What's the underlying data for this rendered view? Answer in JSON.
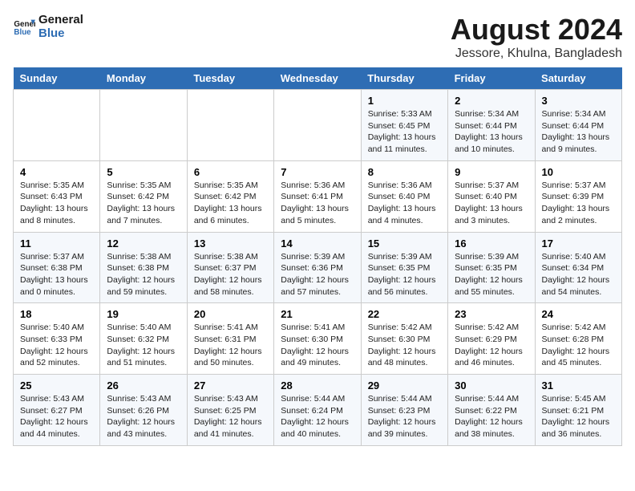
{
  "header": {
    "logo_line1": "General",
    "logo_line2": "Blue",
    "title": "August 2024",
    "subtitle": "Jessore, Khulna, Bangladesh"
  },
  "days_of_week": [
    "Sunday",
    "Monday",
    "Tuesday",
    "Wednesday",
    "Thursday",
    "Friday",
    "Saturday"
  ],
  "weeks": [
    [
      {
        "day": "",
        "detail": ""
      },
      {
        "day": "",
        "detail": ""
      },
      {
        "day": "",
        "detail": ""
      },
      {
        "day": "",
        "detail": ""
      },
      {
        "day": "1",
        "detail": "Sunrise: 5:33 AM\nSunset: 6:45 PM\nDaylight: 13 hours\nand 11 minutes."
      },
      {
        "day": "2",
        "detail": "Sunrise: 5:34 AM\nSunset: 6:44 PM\nDaylight: 13 hours\nand 10 minutes."
      },
      {
        "day": "3",
        "detail": "Sunrise: 5:34 AM\nSunset: 6:44 PM\nDaylight: 13 hours\nand 9 minutes."
      }
    ],
    [
      {
        "day": "4",
        "detail": "Sunrise: 5:35 AM\nSunset: 6:43 PM\nDaylight: 13 hours\nand 8 minutes."
      },
      {
        "day": "5",
        "detail": "Sunrise: 5:35 AM\nSunset: 6:42 PM\nDaylight: 13 hours\nand 7 minutes."
      },
      {
        "day": "6",
        "detail": "Sunrise: 5:35 AM\nSunset: 6:42 PM\nDaylight: 13 hours\nand 6 minutes."
      },
      {
        "day": "7",
        "detail": "Sunrise: 5:36 AM\nSunset: 6:41 PM\nDaylight: 13 hours\nand 5 minutes."
      },
      {
        "day": "8",
        "detail": "Sunrise: 5:36 AM\nSunset: 6:40 PM\nDaylight: 13 hours\nand 4 minutes."
      },
      {
        "day": "9",
        "detail": "Sunrise: 5:37 AM\nSunset: 6:40 PM\nDaylight: 13 hours\nand 3 minutes."
      },
      {
        "day": "10",
        "detail": "Sunrise: 5:37 AM\nSunset: 6:39 PM\nDaylight: 13 hours\nand 2 minutes."
      }
    ],
    [
      {
        "day": "11",
        "detail": "Sunrise: 5:37 AM\nSunset: 6:38 PM\nDaylight: 13 hours\nand 0 minutes."
      },
      {
        "day": "12",
        "detail": "Sunrise: 5:38 AM\nSunset: 6:38 PM\nDaylight: 12 hours\nand 59 minutes."
      },
      {
        "day": "13",
        "detail": "Sunrise: 5:38 AM\nSunset: 6:37 PM\nDaylight: 12 hours\nand 58 minutes."
      },
      {
        "day": "14",
        "detail": "Sunrise: 5:39 AM\nSunset: 6:36 PM\nDaylight: 12 hours\nand 57 minutes."
      },
      {
        "day": "15",
        "detail": "Sunrise: 5:39 AM\nSunset: 6:35 PM\nDaylight: 12 hours\nand 56 minutes."
      },
      {
        "day": "16",
        "detail": "Sunrise: 5:39 AM\nSunset: 6:35 PM\nDaylight: 12 hours\nand 55 minutes."
      },
      {
        "day": "17",
        "detail": "Sunrise: 5:40 AM\nSunset: 6:34 PM\nDaylight: 12 hours\nand 54 minutes."
      }
    ],
    [
      {
        "day": "18",
        "detail": "Sunrise: 5:40 AM\nSunset: 6:33 PM\nDaylight: 12 hours\nand 52 minutes."
      },
      {
        "day": "19",
        "detail": "Sunrise: 5:40 AM\nSunset: 6:32 PM\nDaylight: 12 hours\nand 51 minutes."
      },
      {
        "day": "20",
        "detail": "Sunrise: 5:41 AM\nSunset: 6:31 PM\nDaylight: 12 hours\nand 50 minutes."
      },
      {
        "day": "21",
        "detail": "Sunrise: 5:41 AM\nSunset: 6:30 PM\nDaylight: 12 hours\nand 49 minutes."
      },
      {
        "day": "22",
        "detail": "Sunrise: 5:42 AM\nSunset: 6:30 PM\nDaylight: 12 hours\nand 48 minutes."
      },
      {
        "day": "23",
        "detail": "Sunrise: 5:42 AM\nSunset: 6:29 PM\nDaylight: 12 hours\nand 46 minutes."
      },
      {
        "day": "24",
        "detail": "Sunrise: 5:42 AM\nSunset: 6:28 PM\nDaylight: 12 hours\nand 45 minutes."
      }
    ],
    [
      {
        "day": "25",
        "detail": "Sunrise: 5:43 AM\nSunset: 6:27 PM\nDaylight: 12 hours\nand 44 minutes."
      },
      {
        "day": "26",
        "detail": "Sunrise: 5:43 AM\nSunset: 6:26 PM\nDaylight: 12 hours\nand 43 minutes."
      },
      {
        "day": "27",
        "detail": "Sunrise: 5:43 AM\nSunset: 6:25 PM\nDaylight: 12 hours\nand 41 minutes."
      },
      {
        "day": "28",
        "detail": "Sunrise: 5:44 AM\nSunset: 6:24 PM\nDaylight: 12 hours\nand 40 minutes."
      },
      {
        "day": "29",
        "detail": "Sunrise: 5:44 AM\nSunset: 6:23 PM\nDaylight: 12 hours\nand 39 minutes."
      },
      {
        "day": "30",
        "detail": "Sunrise: 5:44 AM\nSunset: 6:22 PM\nDaylight: 12 hours\nand 38 minutes."
      },
      {
        "day": "31",
        "detail": "Sunrise: 5:45 AM\nSunset: 6:21 PM\nDaylight: 12 hours\nand 36 minutes."
      }
    ]
  ]
}
